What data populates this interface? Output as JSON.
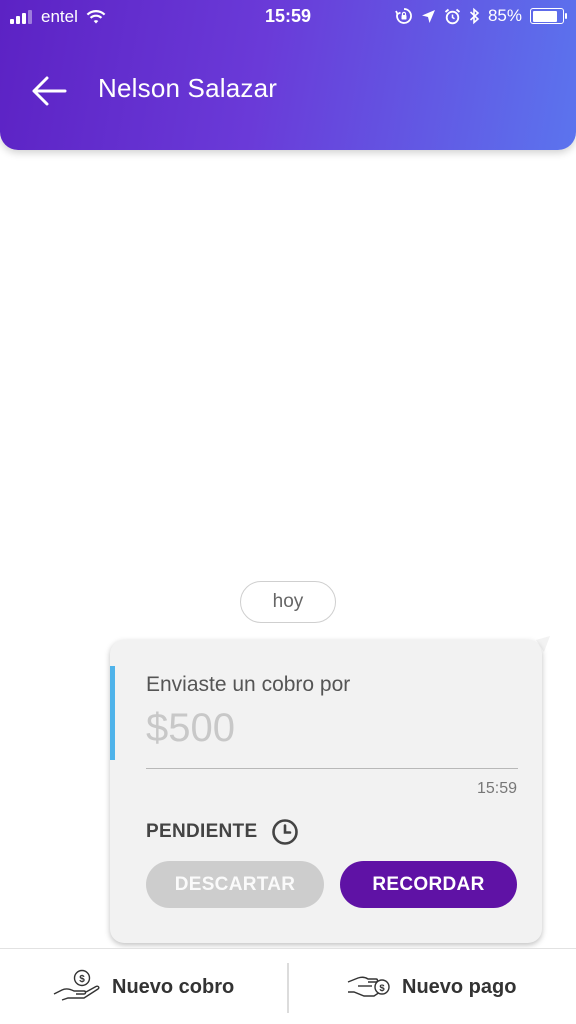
{
  "status_bar": {
    "carrier": "entel",
    "time": "15:59",
    "battery": "85%",
    "battery_level": 0.85
  },
  "header": {
    "back_icon": "arrow-left-icon",
    "title": "Nelson Salazar"
  },
  "chat": {
    "date_label": "hoy",
    "message": {
      "caption": "Enviaste un cobro por",
      "amount": "$500",
      "time": "15:59",
      "status": "PENDIENTE",
      "status_icon": "clock-icon",
      "discard_label": "DESCARTAR",
      "remind_label": "RECORDAR",
      "accent_color": "#4fb3ea"
    }
  },
  "bottom_nav": {
    "new_charge_label": "Nuevo cobro",
    "new_charge_icon": "hand-coin-icon",
    "new_payment_label": "Nuevo pago",
    "new_payment_icon": "hand-give-coin-icon"
  },
  "colors": {
    "header_gradient_start": "#5c22c4",
    "header_gradient_end": "#5b74ee",
    "primary_button": "#5f12a5",
    "disabled_button": "#cdcdcd"
  }
}
